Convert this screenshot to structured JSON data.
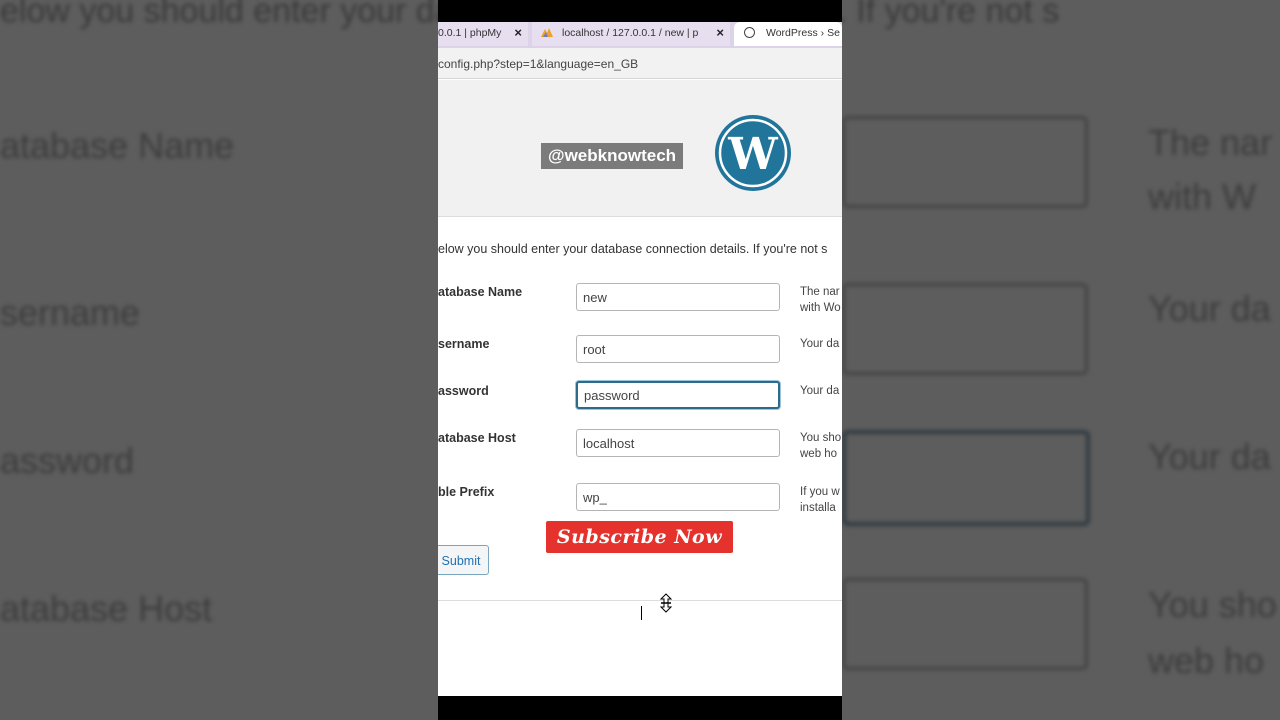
{
  "background": {
    "intro_text": "elow you should enter your database connection details. If you're not s",
    "labels": [
      "atabase Name",
      "sername",
      "assword",
      "atabase Host"
    ],
    "descriptions": [
      "The nar",
      "with W",
      "Your da",
      "Your da",
      "Your da",
      "You sho",
      "web ho"
    ]
  },
  "browser": {
    "tabs": [
      {
        "label": "0.0.1 | phpMy",
        "close": "×"
      },
      {
        "label": "localhost / 127.0.0.1 / new | p",
        "close": "×"
      },
      {
        "label": "WordPress › Se"
      }
    ],
    "address": "config.php?step=1&language=en_GB"
  },
  "overlay": {
    "handle": "@webknowtech",
    "subscribe": "Subscribe Now"
  },
  "form": {
    "intro": "elow you should enter your database connection details. If you're not s",
    "fields": [
      {
        "label": "atabase Name",
        "value": "new",
        "desc1": "The nar",
        "desc2": "with Wo"
      },
      {
        "label": "sername",
        "value": "root",
        "desc1": "Your da",
        "desc2": ""
      },
      {
        "label": "assword",
        "value": "password",
        "desc1": "Your da",
        "desc2": ""
      },
      {
        "label": "atabase Host",
        "value": "localhost",
        "desc1": "You sho",
        "desc2": "web ho"
      },
      {
        "label": "ble Prefix",
        "value": "wp_",
        "desc1": "If you w",
        "desc2": "installa"
      }
    ],
    "submit": "Submit"
  },
  "colors": {
    "wordpress_blue": "#21759b",
    "subscribe_red": "#e5322d",
    "focus_border": "#2c6b8a"
  }
}
